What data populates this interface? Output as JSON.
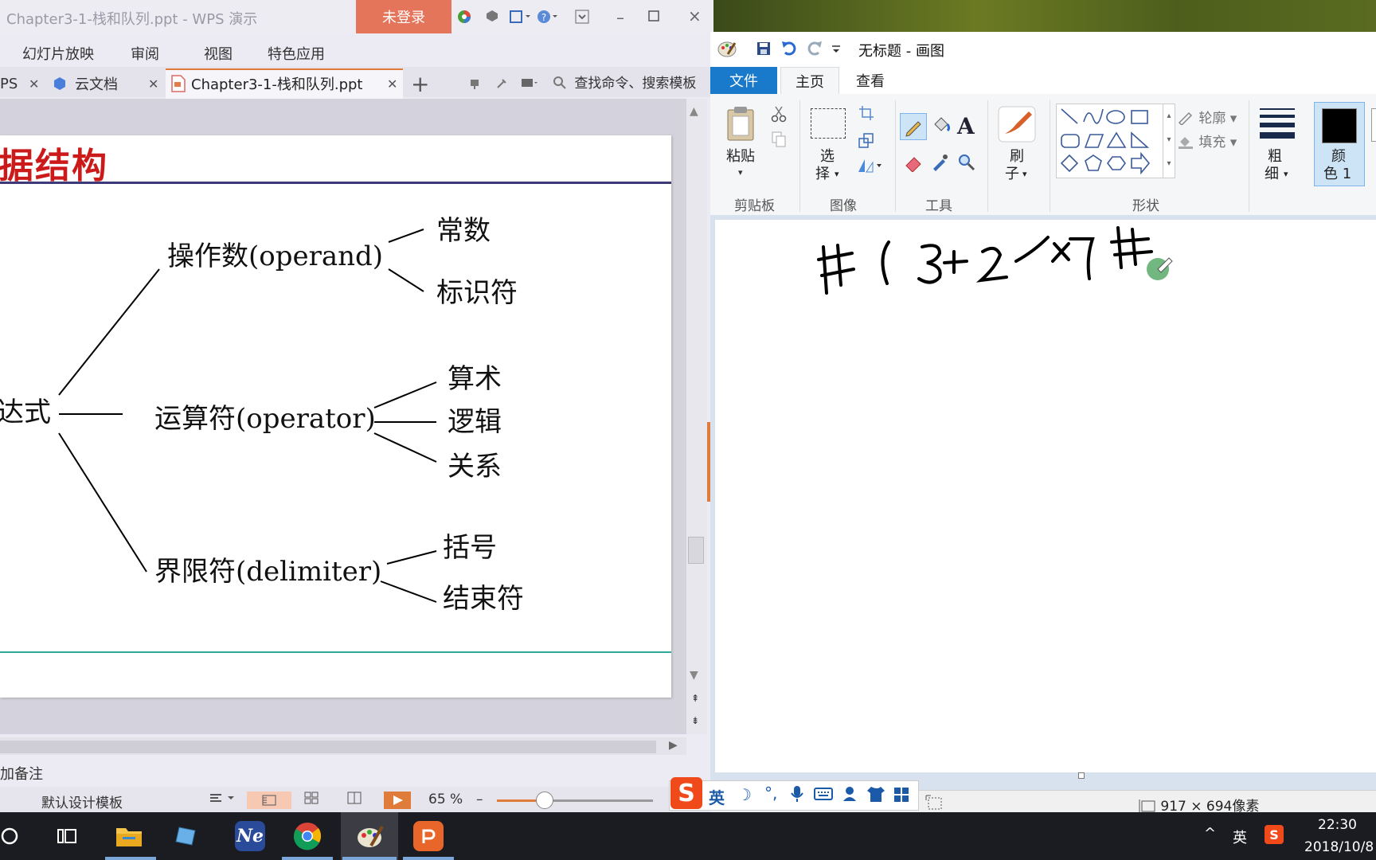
{
  "wps": {
    "title": "Chapter3-1-栈和队列.ppt - WPS 演示",
    "login": "未登录",
    "menu": [
      "幻灯片放映",
      "审阅",
      "视图",
      "特色应用"
    ],
    "tabs": [
      "PS",
      "云文档",
      "Chapter3-1-栈和队列.ppt"
    ],
    "search": "查找命令、搜索模板",
    "notes": "加备注",
    "template": "默认设计模板",
    "zoom": "65 %"
  },
  "slide": {
    "heading": "据结构",
    "root": "达式",
    "branches": [
      {
        "label": "操作数(operand)",
        "children": [
          "常数",
          "标识符"
        ]
      },
      {
        "label": "运算符(operator)",
        "children": [
          "算术",
          "逻辑",
          "关系"
        ]
      },
      {
        "label": "界限符(delimiter)",
        "children": [
          "括号",
          "结束符"
        ]
      }
    ]
  },
  "paint": {
    "title": "无标题 - 画图",
    "tabs": [
      "文件",
      "主页",
      "查看"
    ],
    "groups": [
      "剪贴板",
      "图像",
      "工具",
      "形状"
    ],
    "paste": "粘贴",
    "select": [
      "选",
      "择"
    ],
    "brush": [
      "刷",
      "子"
    ],
    "outline": "轮廓",
    "fill": "填充",
    "size": [
      "粗",
      "细"
    ],
    "color1": [
      "颜",
      "色 1"
    ],
    "canvas_size": "917 × 694像素"
  },
  "ime": {
    "lang": "英"
  },
  "tray": {
    "lang": "英",
    "time": "22:30",
    "date": "2018/10/8"
  }
}
